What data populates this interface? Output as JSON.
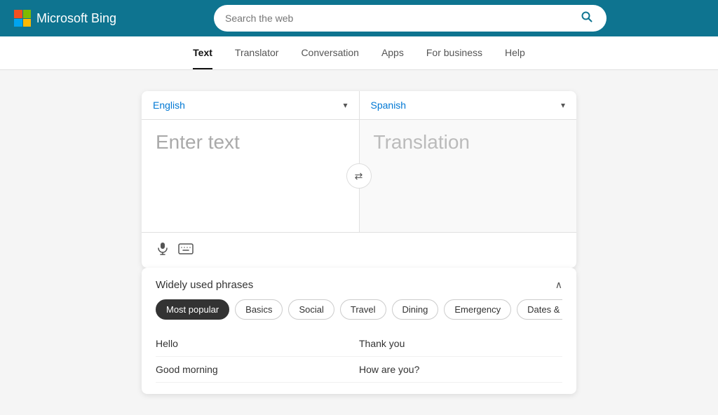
{
  "header": {
    "logo_text": "Microsoft Bing",
    "search_placeholder": "Search the web"
  },
  "nav": {
    "tabs": [
      {
        "id": "text",
        "label": "Text",
        "active": true
      },
      {
        "id": "translator",
        "label": "Translator",
        "active": false
      },
      {
        "id": "conversation",
        "label": "Conversation",
        "active": false
      },
      {
        "id": "apps",
        "label": "Apps",
        "active": false
      },
      {
        "id": "for-business",
        "label": "For business",
        "active": false
      },
      {
        "id": "help",
        "label": "Help",
        "active": false
      }
    ]
  },
  "translator": {
    "source_lang": "English",
    "target_lang": "Spanish",
    "input_placeholder": "Enter text",
    "output_placeholder": "Translation",
    "swap_icon": "⇄"
  },
  "phrases": {
    "title": "Widely used phrases",
    "tags": [
      {
        "id": "most-popular",
        "label": "Most popular",
        "active": true
      },
      {
        "id": "basics",
        "label": "Basics",
        "active": false
      },
      {
        "id": "social",
        "label": "Social",
        "active": false
      },
      {
        "id": "travel",
        "label": "Travel",
        "active": false
      },
      {
        "id": "dining",
        "label": "Dining",
        "active": false
      },
      {
        "id": "emergency",
        "label": "Emergency",
        "active": false
      },
      {
        "id": "dates-numbers",
        "label": "Dates & num",
        "active": false
      }
    ],
    "items": [
      {
        "col": "left",
        "text": "Hello"
      },
      {
        "col": "right",
        "text": "Thank you"
      },
      {
        "col": "left",
        "text": "Good morning"
      },
      {
        "col": "right",
        "text": "How are you?"
      }
    ]
  }
}
